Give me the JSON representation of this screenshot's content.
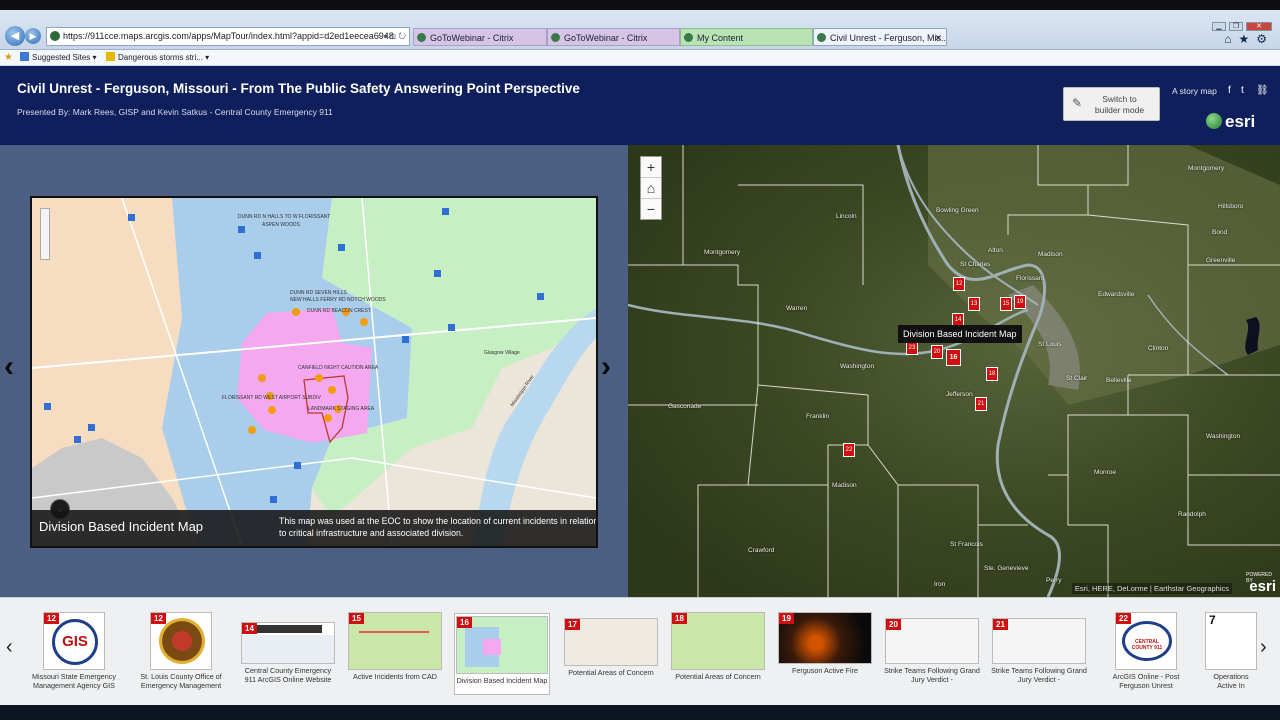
{
  "browser": {
    "url": "https://911cce.maps.arcgis.com/apps/MapTour/index.html?appid=d2ed1eecea6948",
    "tabs": [
      {
        "label": "GoToWebinar - Citrix",
        "color": "#d6c4e6"
      },
      {
        "label": "GoToWebinar - Citrix",
        "color": "#d6c4e6"
      },
      {
        "label": "My Content",
        "color": "#b9e3b5"
      },
      {
        "label": "Civil Unrest - Ferguson, Mis...",
        "color": "#eef3fa"
      }
    ],
    "favorites": [
      "Suggested Sites ▾",
      "Dangerous storms stri... ▾"
    ]
  },
  "header": {
    "title": "Civil Unrest - Ferguson, Missouri - From The Public Safety Answering Point Perspective",
    "subtitle": "Presented By: Mark Rees, GISP and Kevin Satkus - Central County Emergency 911",
    "builder_line1": "Switch to",
    "builder_line2": "builder mode",
    "story_map_label": "A story map",
    "brand": "esri",
    "bg_color": "#0e1f5b"
  },
  "media": {
    "caption_title": "Division Based Incident Map",
    "caption_desc": "This map was used at the EOC to show the location of current incidents in relation to critical infrastructure and associated division.",
    "map_labels": [
      "DUNN RD N HALLS TO W FLORISSANT",
      "ASPEN WOODS",
      "DUNN RD SEVEN HILLS",
      "NEW HALLS FERRY RD NOTCH WOODS",
      "DUNN RD BEACON CREST",
      "CANFIELD NIGHT CAUTION AREA",
      "FLORISSANT RD WEST AIRPORT SUBDIV",
      "LANDMARK STAGING AREA",
      "Glasgow Village",
      "Mississippi River"
    ]
  },
  "main_map": {
    "tooltip": "Division Based Incident Map",
    "places": [
      "Montgomery",
      "Lincoln",
      "Bowling Green",
      "Hillsboro",
      "Alton",
      "St Charles",
      "Florissant",
      "Madison",
      "Bond",
      "Greenville",
      "Montgomery",
      "Warren",
      "St Louis",
      "Edwardsville",
      "Clinton",
      "Washington",
      "Jefferson",
      "St Clair",
      "Belleville",
      "Gasconade",
      "Franklin",
      "Monroe",
      "Washington",
      "Randolph",
      "Crawford",
      "St Francois",
      "Ste. Genevieve",
      "Perry",
      "Iron",
      "Madison"
    ],
    "attribution": "Esri, HERE, DeLorme | Earthstar Geographics",
    "powered": "esri",
    "powered_small": "POWERED BY"
  },
  "carousel": {
    "items": [
      {
        "num": "12",
        "label": "Missouri State Emergency Management Agency GIS"
      },
      {
        "num": "12",
        "label": "St. Louis County Office of Emergency Management"
      },
      {
        "num": "14",
        "label": "Central County Emergency 911 ArcGIS Online Website"
      },
      {
        "num": "15",
        "label": "Active Incidents from CAD"
      },
      {
        "num": "16",
        "label": "Division Based Incident Map"
      },
      {
        "num": "17",
        "label": "Potential Areas of Concern"
      },
      {
        "num": "18",
        "label": "Potential Areas of Concern"
      },
      {
        "num": "19",
        "label": "Ferguson Active Fire"
      },
      {
        "num": "20",
        "label": "Strike Teams Following Grand Jury Verdict -"
      },
      {
        "num": "21",
        "label": "Strike Teams Following Grand Jury Verdict -"
      },
      {
        "num": "22",
        "label": "ArcGIS Online - Post Ferguson Unrest"
      },
      {
        "num": "7",
        "label": "Operations Active In"
      }
    ],
    "active_index": 4,
    "gis_logo_text": "GIS",
    "badge_text": "CENTRAL COUNTY 911"
  },
  "markers": [
    "12",
    "13",
    "14",
    "15",
    "16",
    "18",
    "19",
    "20",
    "21",
    "22",
    "23"
  ],
  "colors": {
    "left_panel_bg": "#4b5f82",
    "caption_bg": "#141414",
    "active_marker": "#d01010"
  }
}
